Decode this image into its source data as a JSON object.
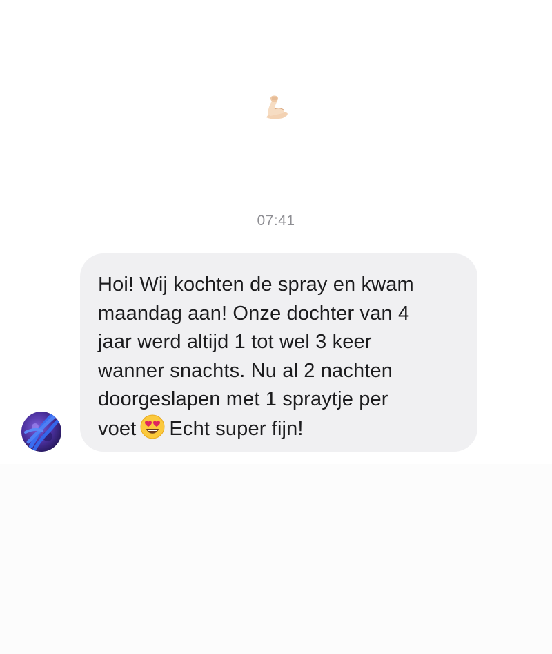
{
  "top": {
    "reaction_icon": "flexed-biceps-icon"
  },
  "chat": {
    "timestamp": "07:41",
    "message": {
      "line1": "Hoi! Wij kochten de spray en kwam",
      "line2": "maandag aan! Onze dochter van 4",
      "line3": "jaar werd altijd 1 tot wel 3 keer",
      "line4": "wanner snachts. Nu al 2 nachten",
      "line5": "doorgeslapen met 1 spraytje per",
      "line6a": "voet",
      "line6_emoji": "heart-eyes-emoji-icon",
      "line6b": "Echt super fijn!"
    },
    "avatar_icon": "avatar",
    "colors": {
      "bubble": "#f0f0f2",
      "text": "#1c1c1e",
      "timestamp": "#8e8e93"
    }
  }
}
